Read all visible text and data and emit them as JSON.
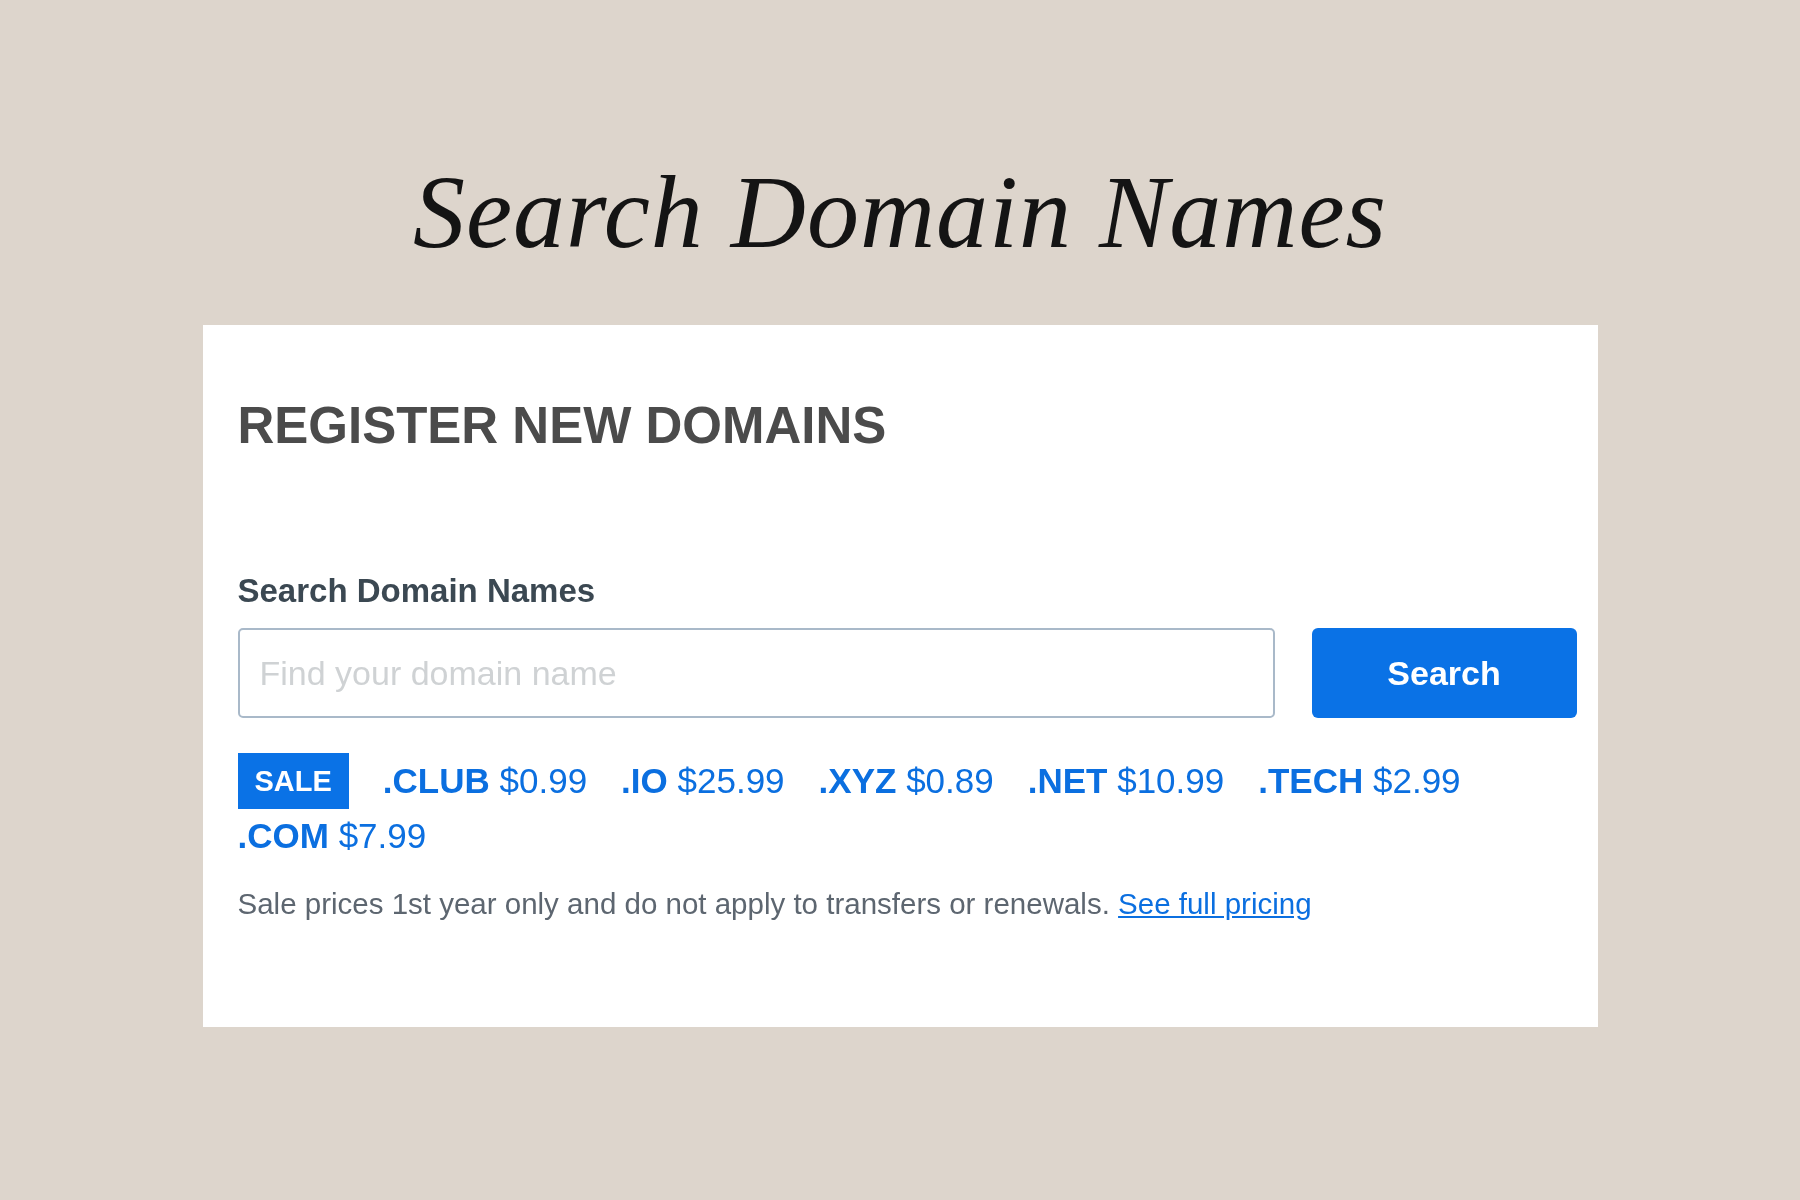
{
  "title": "Search Domain Names",
  "card": {
    "heading": "REGISTER NEW DOMAINS",
    "search": {
      "label": "Search Domain Names",
      "placeholder": "Find your domain name",
      "button": "Search"
    },
    "sale_badge": "SALE",
    "offers": [
      {
        "tld": ".CLUB",
        "price": "$0.99"
      },
      {
        "tld": ".IO",
        "price": "$25.99"
      },
      {
        "tld": ".XYZ",
        "price": "$0.89"
      },
      {
        "tld": ".NET",
        "price": "$10.99"
      },
      {
        "tld": ".TECH",
        "price": "$2.99"
      },
      {
        "tld": ".COM",
        "price": "$7.99"
      }
    ],
    "note": {
      "text": "Sale prices 1st year only and do not apply to transfers or renewals.",
      "link": "See full pricing"
    }
  }
}
